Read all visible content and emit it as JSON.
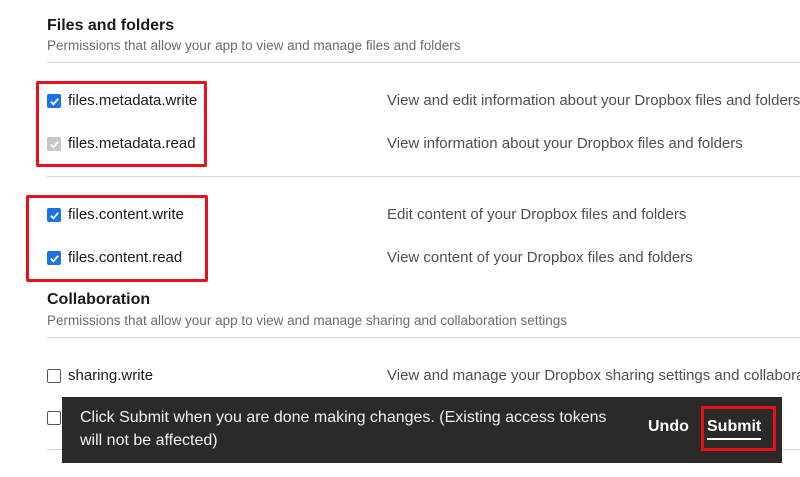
{
  "files_section": {
    "title": "Files and folders",
    "description": "Permissions that allow your app to view and manage files and folders",
    "permissions": [
      {
        "name": "files.metadata.write",
        "description": "View and edit information about your Dropbox files and folders",
        "checked": true,
        "disabled": false
      },
      {
        "name": "files.metadata.read",
        "description": "View information about your Dropbox files and folders",
        "checked": true,
        "disabled": true
      },
      {
        "name": "files.content.write",
        "description": "Edit content of your Dropbox files and folders",
        "checked": true,
        "disabled": false
      },
      {
        "name": "files.content.read",
        "description": "View content of your Dropbox files and folders",
        "checked": true,
        "disabled": false
      }
    ]
  },
  "collaboration_section": {
    "title": "Collaboration",
    "description": "Permissions that allow your app to view and manage sharing and collaboration settings",
    "permissions": [
      {
        "name": "sharing.write",
        "description": "View and manage your Dropbox sharing settings and collaborators",
        "checked": false,
        "disabled": false
      }
    ]
  },
  "toast": {
    "message": "Click Submit when you are done making changes. (Existing access tokens will not be affected)",
    "undo_label": "Undo",
    "submit_label": "Submit"
  },
  "colors": {
    "checkbox_checked": "#1a73e8",
    "checkbox_disabled": "#c7c7c7",
    "highlight_border": "#e8101a",
    "toast_background": "#2b2a28"
  }
}
